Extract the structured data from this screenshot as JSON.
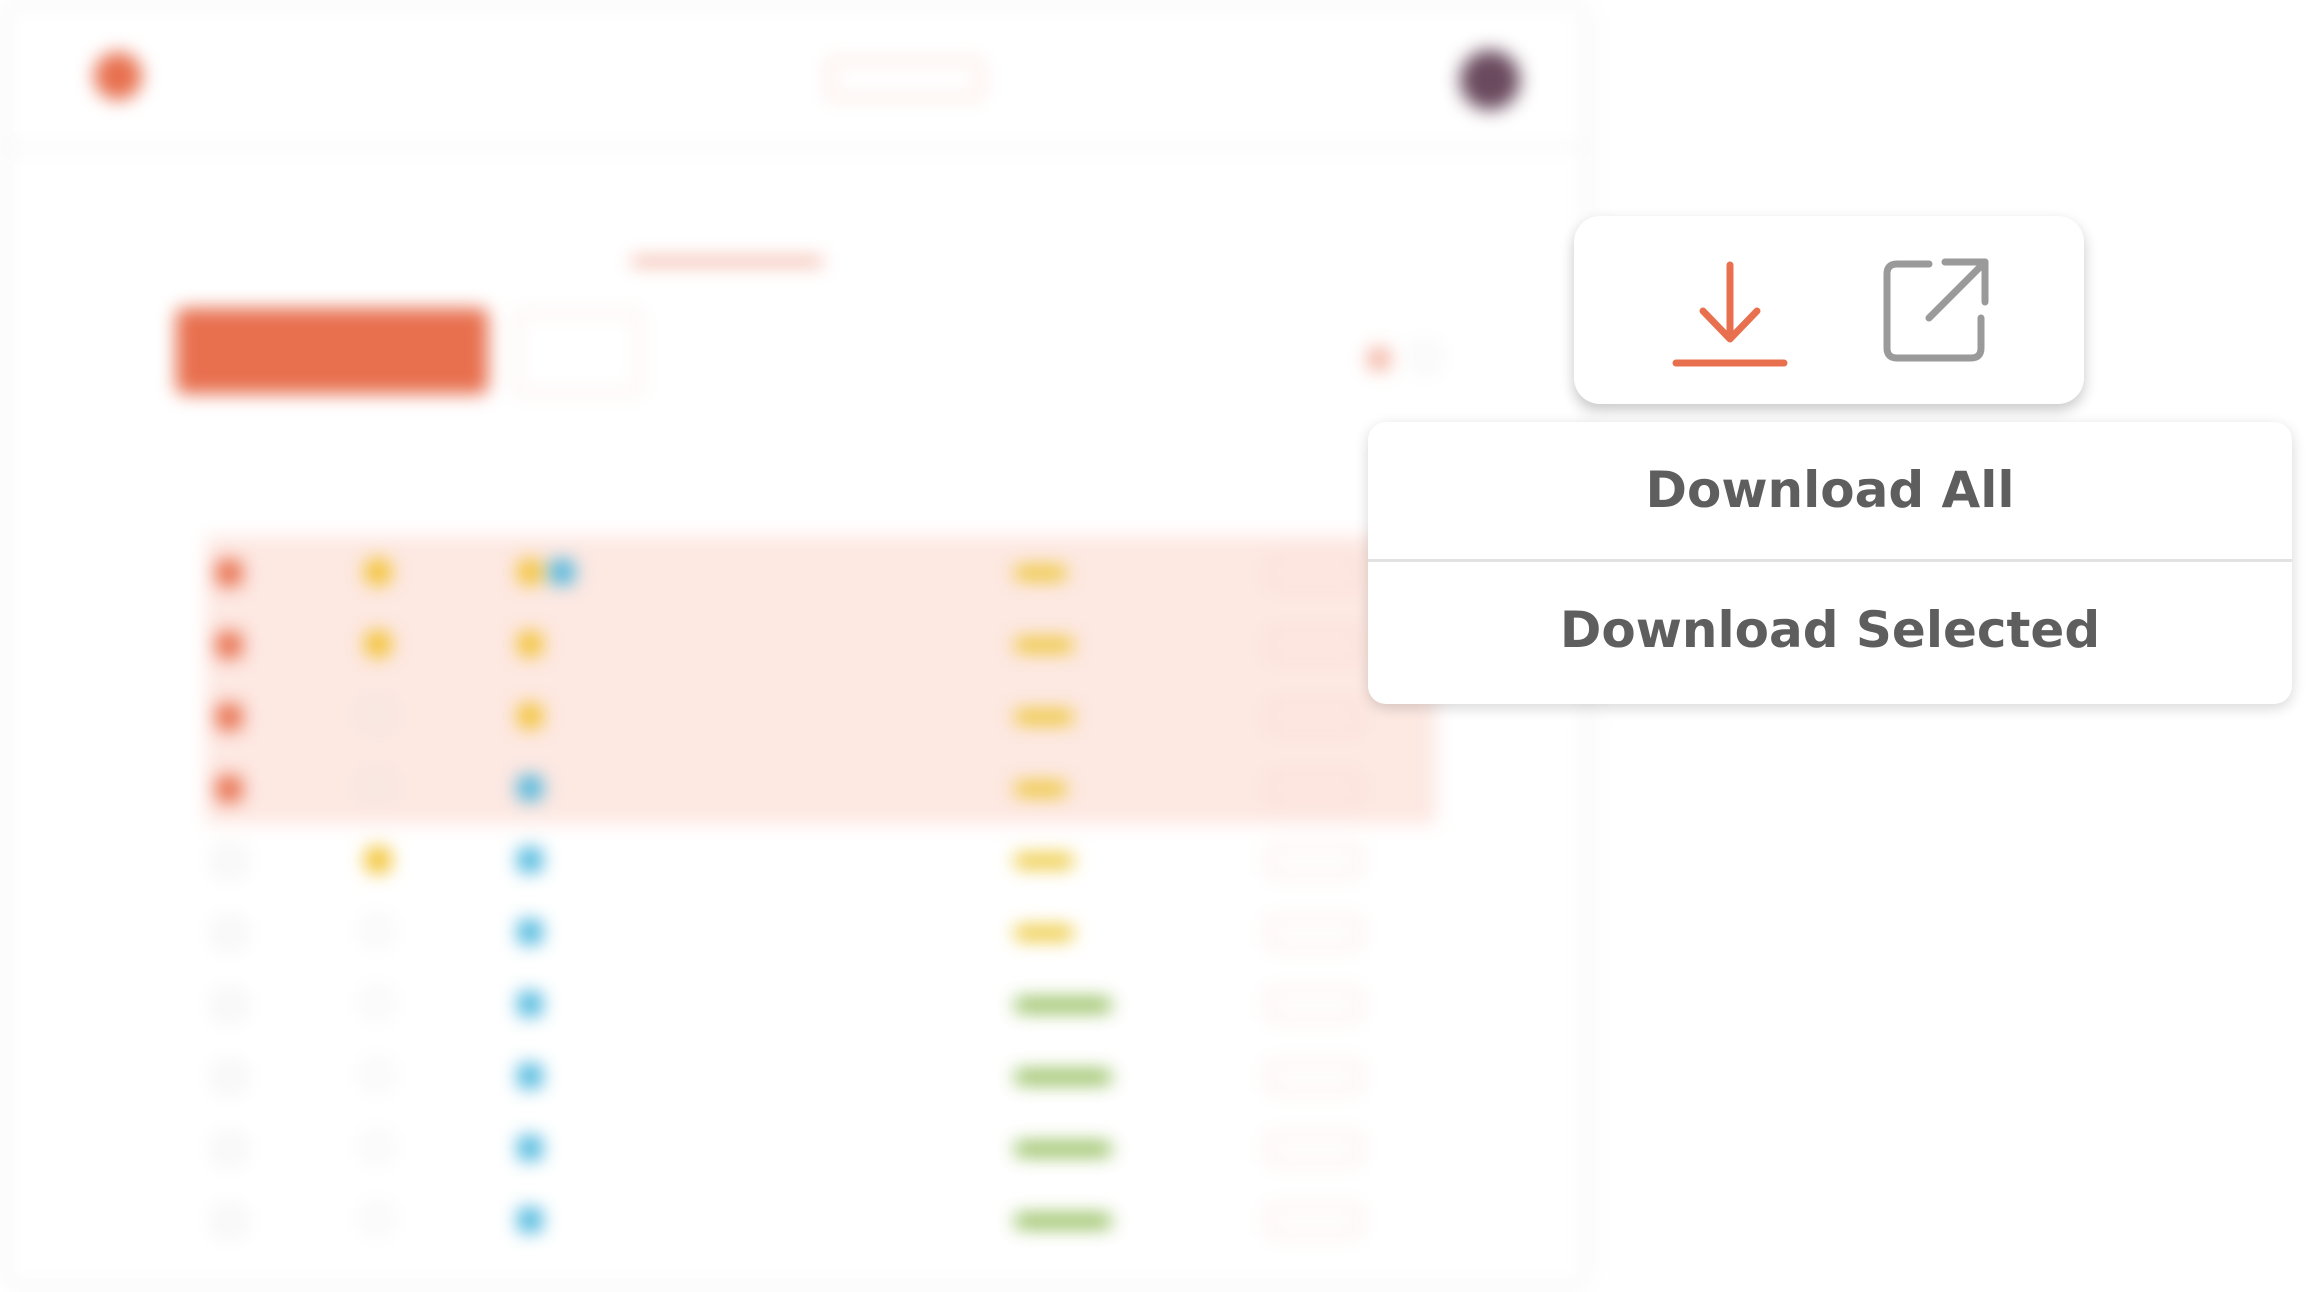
{
  "colors": {
    "accent": "#e8704f",
    "icon_gray": "#9a9a9a",
    "menu_text": "#5e5e5e",
    "row_highlight": "#fde8e2",
    "star_yellow": "#f2c230",
    "tag_yellow": "#f2c230",
    "tag_blue": "#45b4dc",
    "bar_yellow": "#ecc42a",
    "bar_green": "#8ab84e"
  },
  "background_app": {
    "logo_text": "",
    "title": "",
    "title_pill": "",
    "tabs": [
      {
        "label": ""
      },
      {
        "label": ""
      },
      {
        "label": "",
        "active": true
      }
    ],
    "primary_button": "",
    "secondary_button": "",
    "toolbar_labels": [
      "",
      ""
    ],
    "table": {
      "columns": [
        "",
        "",
        "",
        "",
        ""
      ],
      "rows": [
        {
          "highlighted": true,
          "starred": true,
          "tags": [
            "yellow",
            "blue"
          ],
          "link": "",
          "progress": 0.35,
          "bar": "yellow"
        },
        {
          "highlighted": true,
          "starred": true,
          "tags": [
            "yellow"
          ],
          "link": "",
          "progress": 0.4,
          "bar": "yellow"
        },
        {
          "highlighted": true,
          "starred": false,
          "tags": [
            "yellow"
          ],
          "link": "",
          "progress": 0.4,
          "bar": "yellow"
        },
        {
          "highlighted": true,
          "starred": false,
          "tags": [
            "blue"
          ],
          "link": "",
          "progress": 0.35,
          "bar": "yellow"
        },
        {
          "highlighted": false,
          "starred": true,
          "tags": [
            "blue"
          ],
          "link": "",
          "progress": 0.4,
          "bar": "yellow"
        },
        {
          "highlighted": false,
          "starred": false,
          "tags": [
            "blue"
          ],
          "link": "",
          "progress": 0.4,
          "bar": "yellow"
        },
        {
          "highlighted": false,
          "starred": false,
          "tags": [
            "blue"
          ],
          "link": "",
          "progress": 0.65,
          "bar": "green"
        },
        {
          "highlighted": false,
          "starred": false,
          "tags": [
            "blue"
          ],
          "link": "",
          "progress": 0.65,
          "bar": "green"
        },
        {
          "highlighted": false,
          "starred": false,
          "tags": [
            "blue"
          ],
          "link": "",
          "progress": 0.65,
          "bar": "green"
        },
        {
          "highlighted": false,
          "starred": false,
          "tags": [
            "blue"
          ],
          "link": "",
          "progress": 0.65,
          "bar": "green"
        }
      ]
    }
  },
  "actions": {
    "download_icon": "download-icon",
    "external_icon": "external-link-icon"
  },
  "dropdown": {
    "items": [
      {
        "label": "Download All"
      },
      {
        "label": "Download Selected"
      }
    ]
  }
}
